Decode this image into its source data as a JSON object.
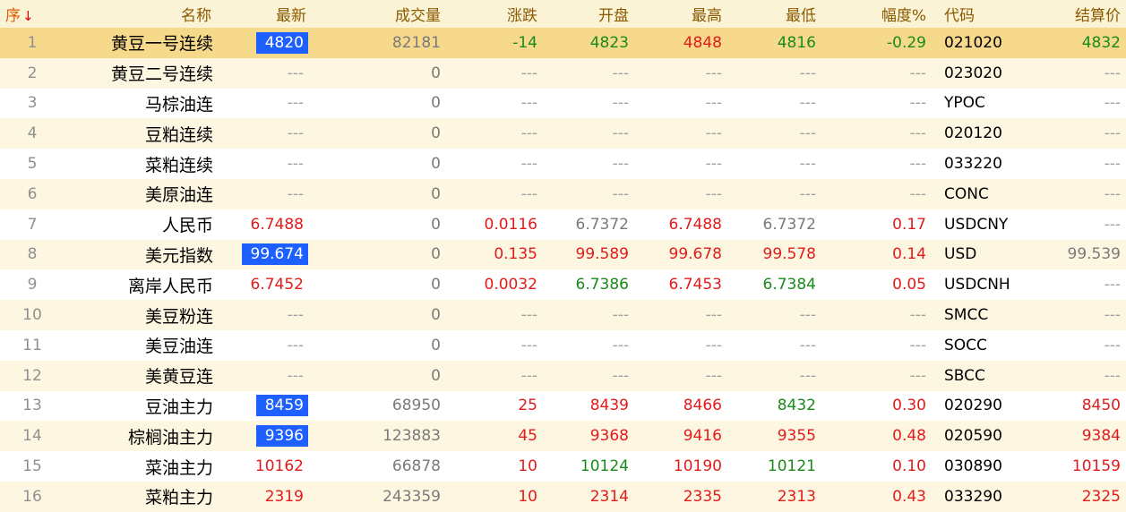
{
  "columns": {
    "index": "序",
    "sort_arrow": "↓",
    "name": "名称",
    "latest": "最新",
    "volume": "成交量",
    "change": "涨跌",
    "open": "开盘",
    "high": "最高",
    "low": "最低",
    "amplitude": "幅度%",
    "code": "代码",
    "settle": "结算价"
  },
  "colors": {
    "up": "#e21b1b",
    "down": "#1a8a1a",
    "highlight": "#1e5fff",
    "selected_row": "#f6d98a"
  },
  "rows": [
    {
      "idx": "1",
      "name": "黄豆一号连续",
      "latest": "4820",
      "latest_hl": true,
      "latest_c": "flat",
      "volume": "82181",
      "change": "-14",
      "change_c": "down",
      "open": "4823",
      "open_c": "down",
      "high": "4848",
      "high_c": "up",
      "low": "4816",
      "low_c": "down",
      "amp": "-0.29",
      "amp_c": "down",
      "code": "021020",
      "settle": "4832",
      "settle_c": "down",
      "selected": true
    },
    {
      "idx": "2",
      "name": "黄豆二号连续",
      "latest": "---",
      "latest_hl": false,
      "latest_c": "dash",
      "volume": "0",
      "change": "---",
      "change_c": "dash",
      "open": "---",
      "open_c": "dash",
      "high": "---",
      "high_c": "dash",
      "low": "---",
      "low_c": "dash",
      "amp": "---",
      "amp_c": "dash",
      "code": "023020",
      "settle": "---",
      "settle_c": "dash",
      "selected": false
    },
    {
      "idx": "3",
      "name": "马棕油连",
      "latest": "---",
      "latest_hl": false,
      "latest_c": "dash",
      "volume": "0",
      "change": "---",
      "change_c": "dash",
      "open": "---",
      "open_c": "dash",
      "high": "---",
      "high_c": "dash",
      "low": "---",
      "low_c": "dash",
      "amp": "---",
      "amp_c": "dash",
      "code": "YPOC",
      "settle": "---",
      "settle_c": "dash",
      "selected": false
    },
    {
      "idx": "4",
      "name": "豆粕连续",
      "latest": "---",
      "latest_hl": false,
      "latest_c": "dash",
      "volume": "0",
      "change": "---",
      "change_c": "dash",
      "open": "---",
      "open_c": "dash",
      "high": "---",
      "high_c": "dash",
      "low": "---",
      "low_c": "dash",
      "amp": "---",
      "amp_c": "dash",
      "code": "020120",
      "settle": "---",
      "settle_c": "dash",
      "selected": false
    },
    {
      "idx": "5",
      "name": "菜粕连续",
      "latest": "---",
      "latest_hl": false,
      "latest_c": "dash",
      "volume": "0",
      "change": "---",
      "change_c": "dash",
      "open": "---",
      "open_c": "dash",
      "high": "---",
      "high_c": "dash",
      "low": "---",
      "low_c": "dash",
      "amp": "---",
      "amp_c": "dash",
      "code": "033220",
      "settle": "---",
      "settle_c": "dash",
      "selected": false
    },
    {
      "idx": "6",
      "name": "美原油连",
      "latest": "---",
      "latest_hl": false,
      "latest_c": "dash",
      "volume": "0",
      "change": "---",
      "change_c": "dash",
      "open": "---",
      "open_c": "dash",
      "high": "---",
      "high_c": "dash",
      "low": "---",
      "low_c": "dash",
      "amp": "---",
      "amp_c": "dash",
      "code": "CONC",
      "settle": "---",
      "settle_c": "dash",
      "selected": false
    },
    {
      "idx": "7",
      "name": "人民币",
      "latest": "6.7488",
      "latest_hl": false,
      "latest_c": "up",
      "volume": "0",
      "change": "0.0116",
      "change_c": "up",
      "open": "6.7372",
      "open_c": "flat",
      "high": "6.7488",
      "high_c": "up",
      "low": "6.7372",
      "low_c": "flat",
      "amp": "0.17",
      "amp_c": "up",
      "code": "USDCNY",
      "settle": "---",
      "settle_c": "dash",
      "selected": false
    },
    {
      "idx": "8",
      "name": "美元指数",
      "latest": "99.674",
      "latest_hl": true,
      "latest_c": "flat",
      "volume": "0",
      "change": "0.135",
      "change_c": "up",
      "open": "99.589",
      "open_c": "up",
      "high": "99.678",
      "high_c": "up",
      "low": "99.578",
      "low_c": "up",
      "amp": "0.14",
      "amp_c": "up",
      "code": "USD",
      "settle": "99.539",
      "settle_c": "flat",
      "selected": false
    },
    {
      "idx": "9",
      "name": "离岸人民币",
      "latest": "6.7452",
      "latest_hl": false,
      "latest_c": "up",
      "volume": "0",
      "change": "0.0032",
      "change_c": "up",
      "open": "6.7386",
      "open_c": "down",
      "high": "6.7453",
      "high_c": "up",
      "low": "6.7384",
      "low_c": "down",
      "amp": "0.05",
      "amp_c": "up",
      "code": "USDCNH",
      "settle": "---",
      "settle_c": "dash",
      "selected": false
    },
    {
      "idx": "10",
      "name": "美豆粉连",
      "latest": "---",
      "latest_hl": false,
      "latest_c": "dash",
      "volume": "0",
      "change": "---",
      "change_c": "dash",
      "open": "---",
      "open_c": "dash",
      "high": "---",
      "high_c": "dash",
      "low": "---",
      "low_c": "dash",
      "amp": "---",
      "amp_c": "dash",
      "code": "SMCC",
      "settle": "---",
      "settle_c": "dash",
      "selected": false
    },
    {
      "idx": "11",
      "name": "美豆油连",
      "latest": "---",
      "latest_hl": false,
      "latest_c": "dash",
      "volume": "0",
      "change": "---",
      "change_c": "dash",
      "open": "---",
      "open_c": "dash",
      "high": "---",
      "high_c": "dash",
      "low": "---",
      "low_c": "dash",
      "amp": "---",
      "amp_c": "dash",
      "code": "SOCC",
      "settle": "---",
      "settle_c": "dash",
      "selected": false
    },
    {
      "idx": "12",
      "name": "美黄豆连",
      "latest": "---",
      "latest_hl": false,
      "latest_c": "dash",
      "volume": "0",
      "change": "---",
      "change_c": "dash",
      "open": "---",
      "open_c": "dash",
      "high": "---",
      "high_c": "dash",
      "low": "---",
      "low_c": "dash",
      "amp": "---",
      "amp_c": "dash",
      "code": "SBCC",
      "settle": "---",
      "settle_c": "dash",
      "selected": false
    },
    {
      "idx": "13",
      "name": "豆油主力",
      "latest": "8459",
      "latest_hl": true,
      "latest_c": "flat",
      "volume": "68950",
      "change": "25",
      "change_c": "up",
      "open": "8439",
      "open_c": "up",
      "high": "8466",
      "high_c": "up",
      "low": "8432",
      "low_c": "down",
      "amp": "0.30",
      "amp_c": "up",
      "code": "020290",
      "settle": "8450",
      "settle_c": "up",
      "selected": false
    },
    {
      "idx": "14",
      "name": "棕榈油主力",
      "latest": "9396",
      "latest_hl": true,
      "latest_c": "flat",
      "volume": "123883",
      "change": "45",
      "change_c": "up",
      "open": "9368",
      "open_c": "up",
      "high": "9416",
      "high_c": "up",
      "low": "9355",
      "low_c": "up",
      "amp": "0.48",
      "amp_c": "up",
      "code": "020590",
      "settle": "9384",
      "settle_c": "up",
      "selected": false
    },
    {
      "idx": "15",
      "name": "菜油主力",
      "latest": "10162",
      "latest_hl": false,
      "latest_c": "up",
      "volume": "66878",
      "change": "10",
      "change_c": "up",
      "open": "10124",
      "open_c": "down",
      "high": "10190",
      "high_c": "up",
      "low": "10121",
      "low_c": "down",
      "amp": "0.10",
      "amp_c": "up",
      "code": "030890",
      "settle": "10159",
      "settle_c": "up",
      "selected": false
    },
    {
      "idx": "16",
      "name": "菜粕主力",
      "latest": "2319",
      "latest_hl": false,
      "latest_c": "up",
      "volume": "243359",
      "change": "10",
      "change_c": "up",
      "open": "2314",
      "open_c": "up",
      "high": "2335",
      "high_c": "up",
      "low": "2313",
      "low_c": "up",
      "amp": "0.43",
      "amp_c": "up",
      "code": "033290",
      "settle": "2325",
      "settle_c": "up",
      "selected": false
    }
  ]
}
